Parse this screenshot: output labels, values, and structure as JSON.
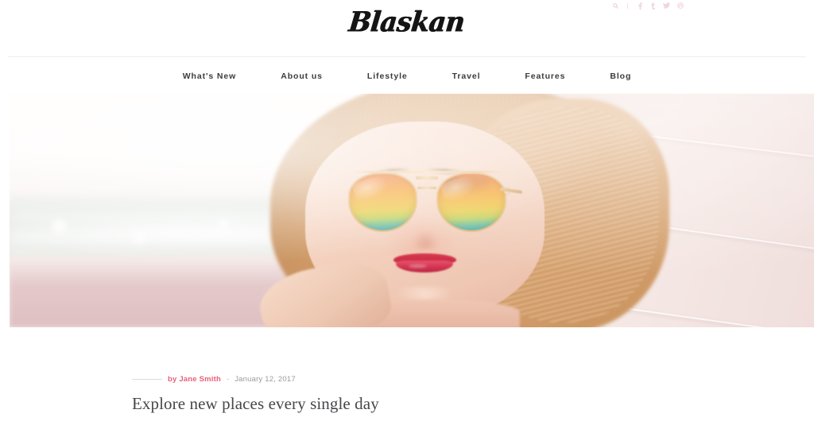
{
  "topbar": {
    "icons": [
      {
        "name": "search-icon",
        "label": "Search"
      },
      {
        "name": "facebook-icon",
        "label": "f"
      },
      {
        "name": "tumblr-icon",
        "label": "t"
      },
      {
        "name": "twitter-icon",
        "label": "Twitter"
      },
      {
        "name": "dribbble-icon",
        "label": "Dribbble"
      }
    ]
  },
  "header": {
    "logo": "Blaskan"
  },
  "nav": {
    "items": [
      {
        "label": "What's New"
      },
      {
        "label": "About us"
      },
      {
        "label": "Lifestyle"
      },
      {
        "label": "Travel"
      },
      {
        "label": "Features"
      },
      {
        "label": "Blog"
      }
    ]
  },
  "hero": {
    "alt": "Woman wearing orange mirrored aviator sunglasses in front of a pale pink plank wall"
  },
  "article": {
    "author_prefix": "by ",
    "author": "by Jane Smith",
    "separator": "-",
    "date": "January 12, 2017",
    "headline": "Explore new places every single day"
  },
  "colors": {
    "accent": "#e8607c",
    "text": "#3c3c3c",
    "headline": "#46474a",
    "muted": "#9d9a9a",
    "rule": "#ededed"
  }
}
